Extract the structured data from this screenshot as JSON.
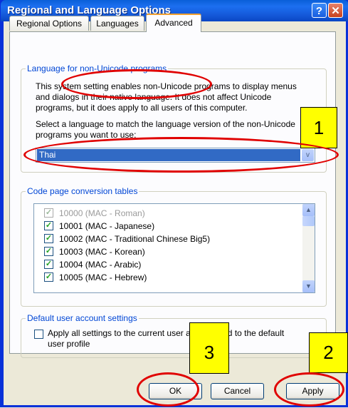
{
  "window": {
    "title": "Regional and Language Options",
    "help_glyph": "?",
    "close_glyph": "✕"
  },
  "tabs": [
    {
      "label": "Regional Options"
    },
    {
      "label": "Languages"
    },
    {
      "label": "Advanced",
      "active": true
    }
  ],
  "nonunicode": {
    "group_label": "Language for non-Unicode programs",
    "description": [
      "This system setting enables non-Unicode programs to display menus",
      "and dialogs in their native language. It does not affect Unicode",
      "programs, but it does apply to all users of this computer."
    ],
    "prompt": [
      "Select a language to match the language version of the non-Unicode",
      "programs you want to use:"
    ],
    "selected_language": "Thai",
    "dropdown_arrow": "v"
  },
  "codepage": {
    "group_label": "Code page conversion tables",
    "items": [
      {
        "label": "10000 (MAC - Roman)",
        "checked": true,
        "disabled": true
      },
      {
        "label": "10001 (MAC - Japanese)",
        "checked": true
      },
      {
        "label": "10002 (MAC - Traditional Chinese Big5)",
        "checked": true
      },
      {
        "label": "10003 (MAC - Korean)",
        "checked": true
      },
      {
        "label": "10004 (MAC - Arabic)",
        "checked": true
      },
      {
        "label": "10005 (MAC - Hebrew)",
        "checked": true
      }
    ]
  },
  "defaults": {
    "group_label": "Default user account settings",
    "checkbox_label": [
      "Apply all settings to the current user account and to the default",
      "user profile"
    ],
    "checked": false
  },
  "buttons": {
    "ok": "OK",
    "cancel": "Cancel",
    "apply": "Apply"
  },
  "annotations": {
    "callouts": [
      "1",
      "2",
      "3"
    ],
    "highlight_color": "#e00000",
    "callout_color": "#ffff00"
  }
}
